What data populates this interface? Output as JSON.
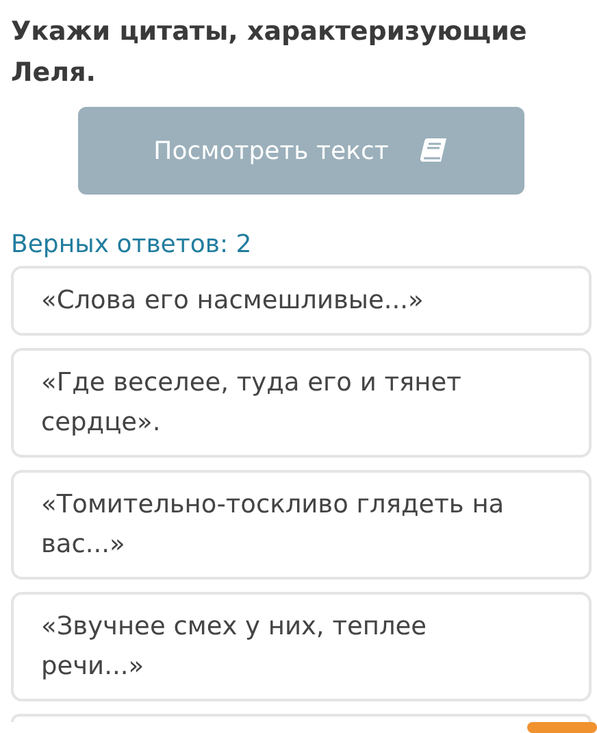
{
  "question": "Укажи цитаты, характеризующие Леля.",
  "view_text_button": {
    "label": "Посмотреть текст"
  },
  "correct_count": "Верных ответов: 2",
  "options": [
    {
      "text": "«Слова его насмешливые...»"
    },
    {
      "text": "«Где веселее, туда его и тянет сердце»."
    },
    {
      "text": "«Томительно-тоскливо глядеть на вас...»"
    },
    {
      "text": "«Звучнее смех у них, теплее речи...»"
    }
  ]
}
